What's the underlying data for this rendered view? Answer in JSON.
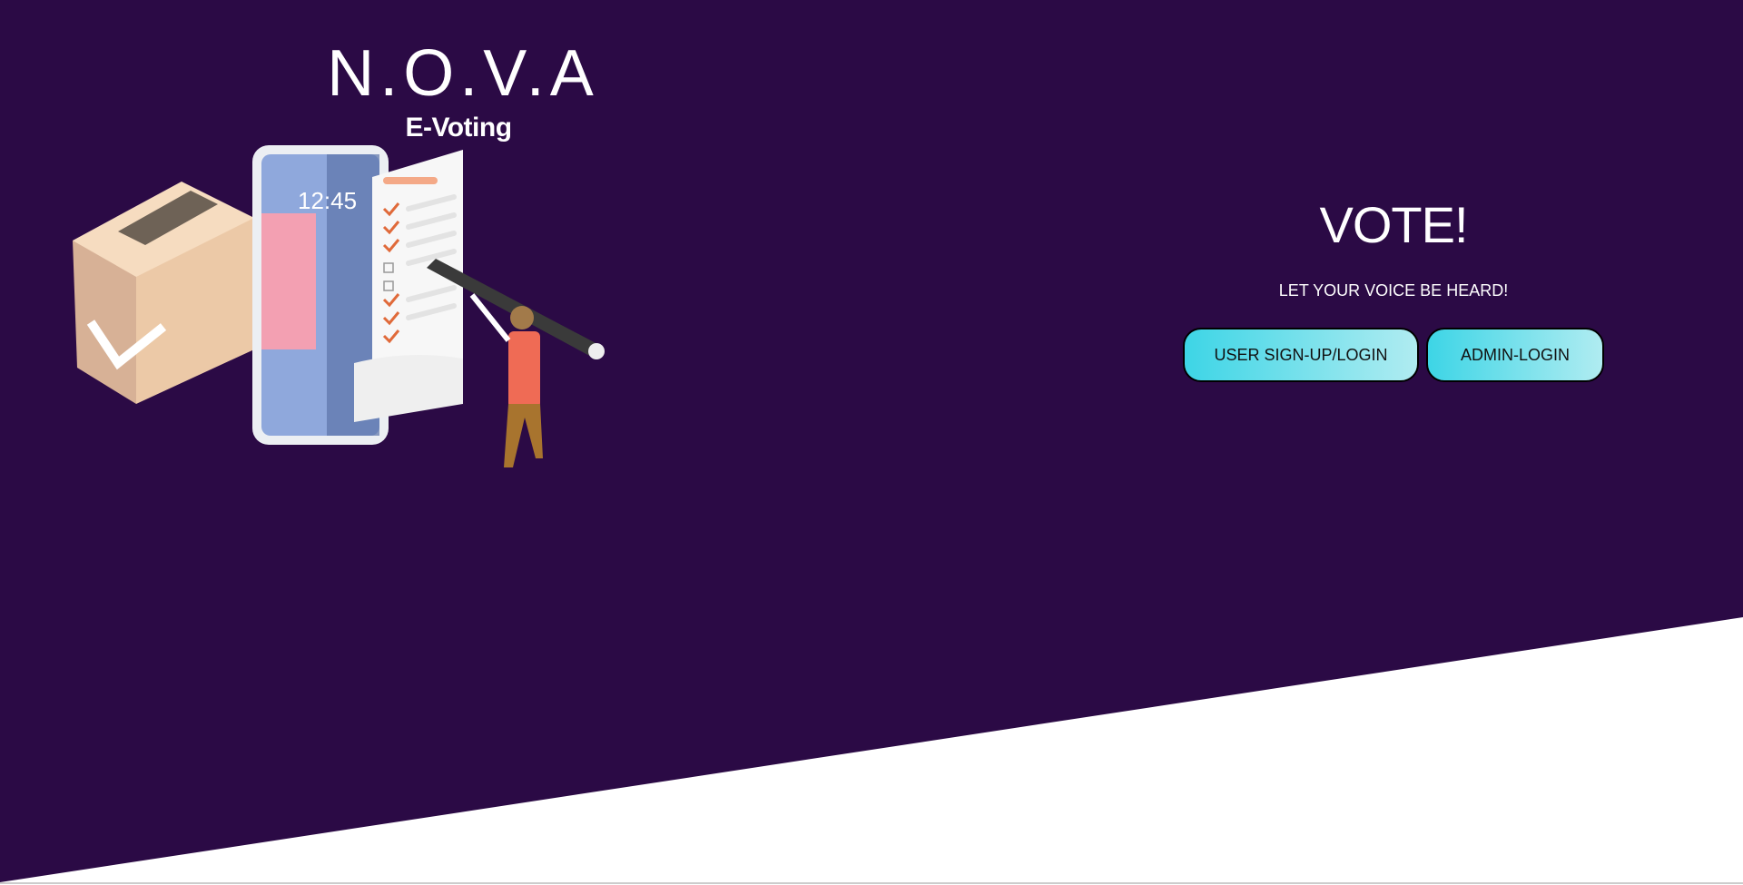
{
  "brand": {
    "title": "N.O.V.A",
    "subtitle": "E-Voting"
  },
  "hero": {
    "heading": "VOTE!",
    "tagline": "LET YOUR VOICE BE HEARD!",
    "buttons": {
      "user": "USER SIGN-UP/LOGIN",
      "admin": "ADMIN-LOGIN"
    }
  },
  "illustration": {
    "phone_time": "12:45"
  },
  "colors": {
    "background": "#2b0a45",
    "button_start": "#3dd5e6",
    "button_end": "#b0ecf1"
  }
}
